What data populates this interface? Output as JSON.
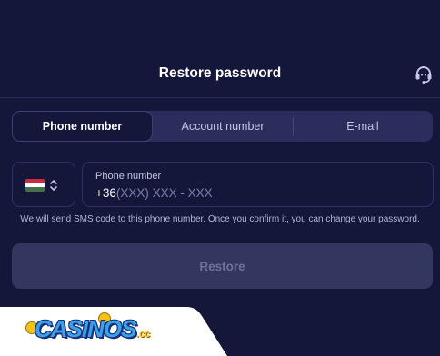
{
  "header": {
    "title": "Restore password",
    "support_icon": "headset-icon"
  },
  "tabs": [
    {
      "label": "Phone number",
      "active": true
    },
    {
      "label": "Account number",
      "active": false
    },
    {
      "label": "E-mail",
      "active": false
    }
  ],
  "country_selector": {
    "flag": "hungary-flag-icon",
    "flag_colors": [
      "#cd2a3e",
      "#ffffff",
      "#436f4d"
    ],
    "chevron": "chevron-up-down-icon"
  },
  "phone_field": {
    "label": "Phone number",
    "prefix": "+36",
    "placeholder": "(XXX) XXX - XXX"
  },
  "hint": "We will send SMS code to this phone number. Once you confirm it, you can change your password.",
  "restore_button": {
    "label": "Restore",
    "enabled": false
  },
  "watermark": {
    "text": "CASINOS",
    "suffix": ".cc"
  },
  "colors": {
    "background": "#14163a",
    "tab_bar": "#2b2e5c",
    "button_disabled": "#33365f",
    "button_text_disabled": "#6e719d"
  }
}
